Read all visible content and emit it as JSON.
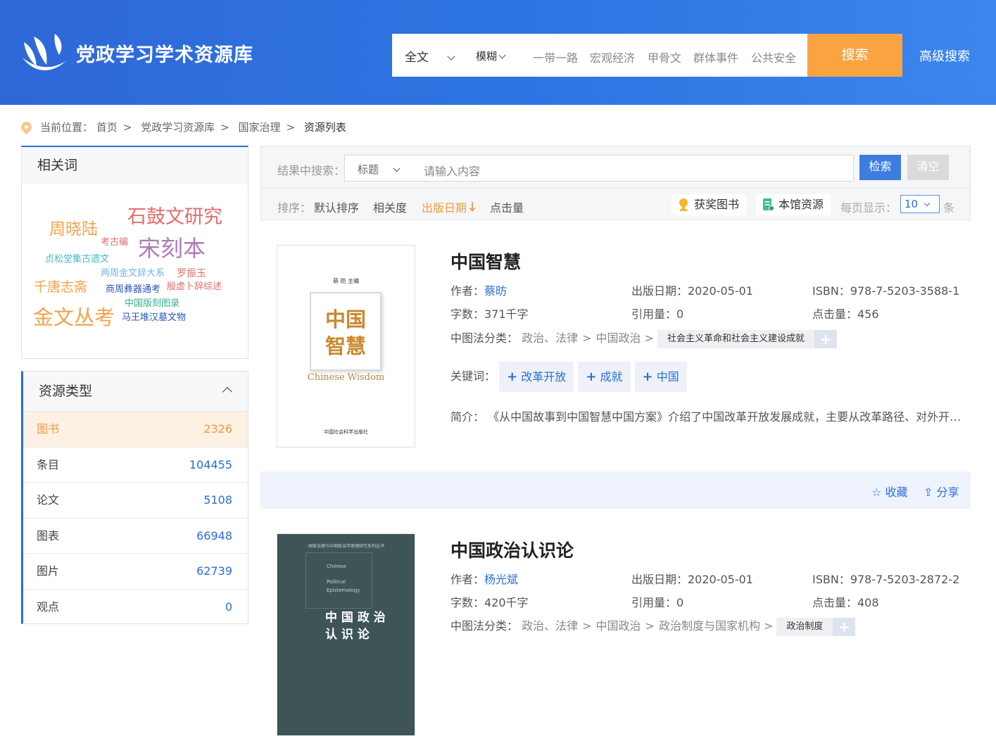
{
  "header": {
    "site_title": "党政学习学术资源库",
    "search": {
      "field": "全文",
      "mode": "模糊",
      "hot_words": [
        "一带一路",
        "宏观经济",
        "甲骨文",
        "群体事件",
        "公共安全"
      ],
      "button": "搜索",
      "advanced": "高级搜索"
    }
  },
  "breadcrumb": {
    "label": "当前位置：",
    "items": [
      "首页",
      "党政学习资源库",
      "国家治理",
      "资源列表"
    ],
    "sep": ">"
  },
  "related": {
    "title": "相关词",
    "words": [
      "石鼓文研究",
      "周晓陆",
      "考古编",
      "宋刻本",
      "贞松堂集古遗文",
      "两周金文辞大系",
      "罗振玉",
      "千唐志斋",
      "商周彝器通考",
      "殷虚卜辞综述",
      "中国版刻图录",
      "金文丛考",
      "马王堆汉墓文物"
    ]
  },
  "resource_types": {
    "title": "资源类型",
    "items": [
      {
        "label": "图书",
        "count": "2326"
      },
      {
        "label": "条目",
        "count": "104455"
      },
      {
        "label": "论文",
        "count": "5108"
      },
      {
        "label": "图表",
        "count": "66948"
      },
      {
        "label": "图片",
        "count": "62739"
      },
      {
        "label": "观点",
        "count": "0"
      }
    ]
  },
  "filter": {
    "label": "结果中搜索：",
    "field": "标题",
    "placeholder": "请输入内容",
    "search_btn": "检索",
    "clear_btn": "清空",
    "sort_label": "排序：",
    "sorts": [
      "默认排序",
      "相关度",
      "出版日期",
      "点击量"
    ],
    "award": "获奖图书",
    "local": "本馆资源",
    "per_page_label": "每页显示：",
    "per_page": "10",
    "per_page_unit": "条"
  },
  "books": [
    {
      "title": "中国智慧",
      "cover_editor": "蔡 昉 主编",
      "cover_title_1": "中国",
      "cover_title_2": "智慧",
      "cover_en": "Chinese Wisdom",
      "cover_publisher": "中国社会科学出版社",
      "author_label": "作者：",
      "author": "蔡昉",
      "date": "出版日期：2020-05-01",
      "isbn": "ISBN：978-7-5203-3588-1",
      "words": "字数：371千字",
      "cites": "引用量：0",
      "clicks": "点击量：456",
      "clc_label": "中图法分类：",
      "clc_path": [
        "政治、法律",
        "中国政治"
      ],
      "clc_tag": "社会主义革命和社会主义建设成就",
      "kw_label": "关键词：",
      "keywords": [
        "改革开放",
        "成就",
        "中国"
      ],
      "summary_label": "简介：",
      "summary": "《从中国故事到中国智慧中国方案》介绍了中国改革开放发展成就，主要从改革路径、对外开放…",
      "fav": "收藏",
      "share": "分享"
    },
    {
      "title": "中国政治认识论",
      "cover_series": "国家治理与中国政治学原理研究系列丛书",
      "cover_en_1": "Chinese",
      "cover_en_2": "Political",
      "cover_en_3": "Epistemology",
      "cover_title": "中 国 政 治",
      "cover_title_2": "认 识 论",
      "author_label": "作者：",
      "author": "杨光斌",
      "date": "出版日期：2020-05-01",
      "isbn": "ISBN：978-7-5203-2872-2",
      "words": "字数：420千字",
      "cites": "引用量：0",
      "clicks": "点击量：408",
      "clc_label": "中图法分类：",
      "clc_path": [
        "政治、法律",
        "中国政治",
        "政治制度与国家机构"
      ],
      "clc_tag": "政治制度"
    }
  ],
  "colors": {
    "primary": "#2a6ed6",
    "accent": "#f9a441",
    "header": "#2f6fdc"
  }
}
